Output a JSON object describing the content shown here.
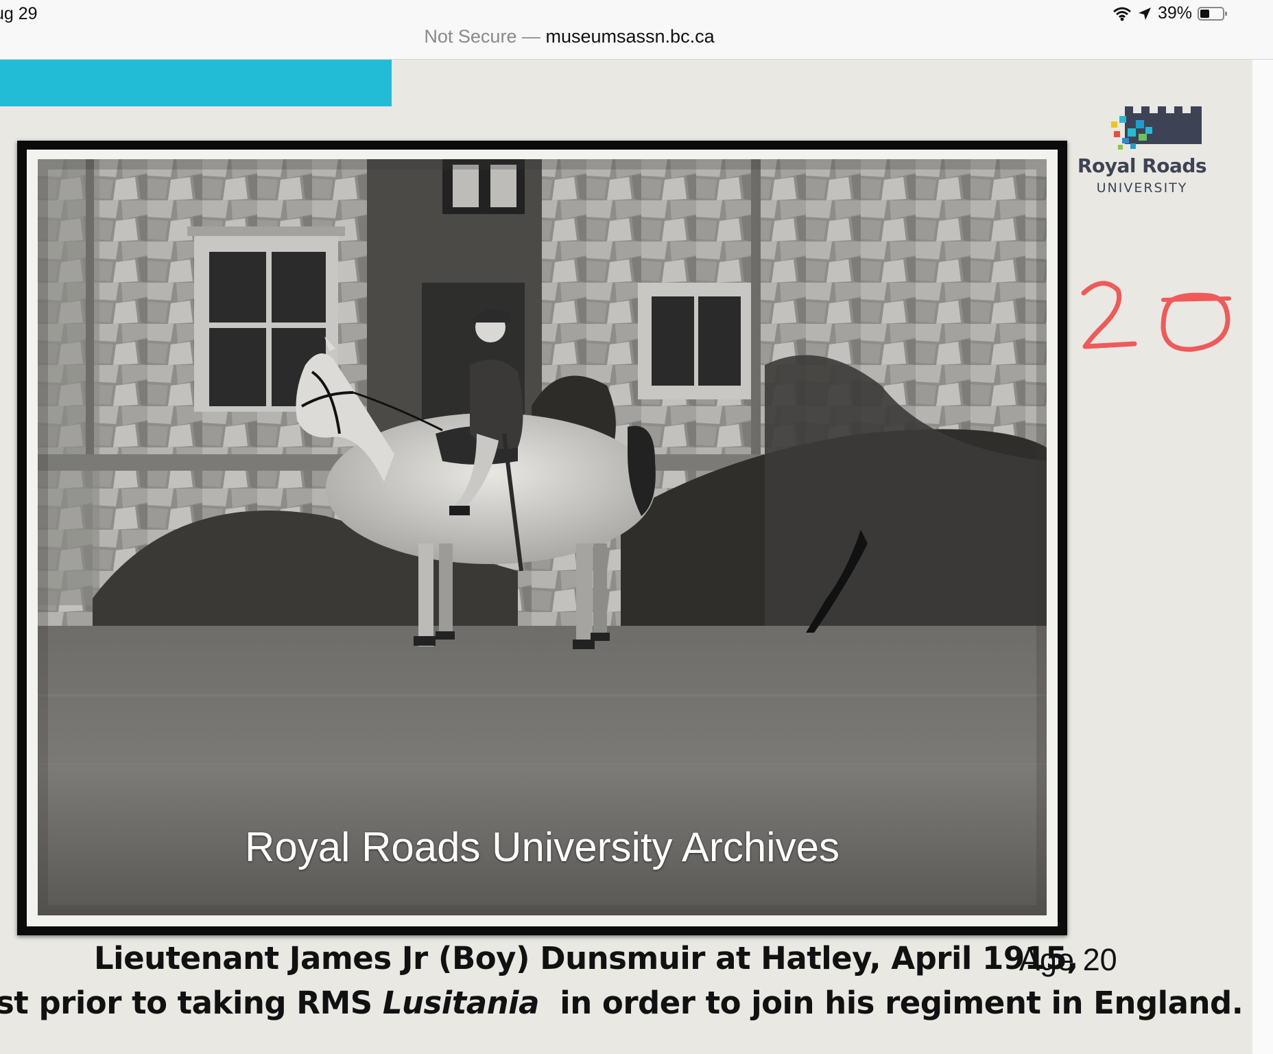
{
  "status_bar": {
    "time": "ug 29",
    "battery": "39%",
    "icons": [
      "wifi-icon",
      "location-arrow-icon",
      "battery-icon"
    ]
  },
  "address_bar": {
    "security": "Not Secure —",
    "domain": "museumsassn.bc.ca"
  },
  "slide": {
    "accent_color": "#22bcd7",
    "logo": {
      "name": "Royal Roads",
      "sub": "UNIVERSITY"
    },
    "handwritten_number": "20",
    "photo": {
      "watermark": "Royal Roads University Archives"
    },
    "caption": {
      "line1": "Lieutenant James Jr (Boy) Dunsmuir at Hatley, April 1915,",
      "age": "Age 20",
      "line2_pre": "st prior to taking RMS ",
      "line2_em": "Lusitania",
      "line2_post": "  in order to join his regiment in England."
    }
  }
}
